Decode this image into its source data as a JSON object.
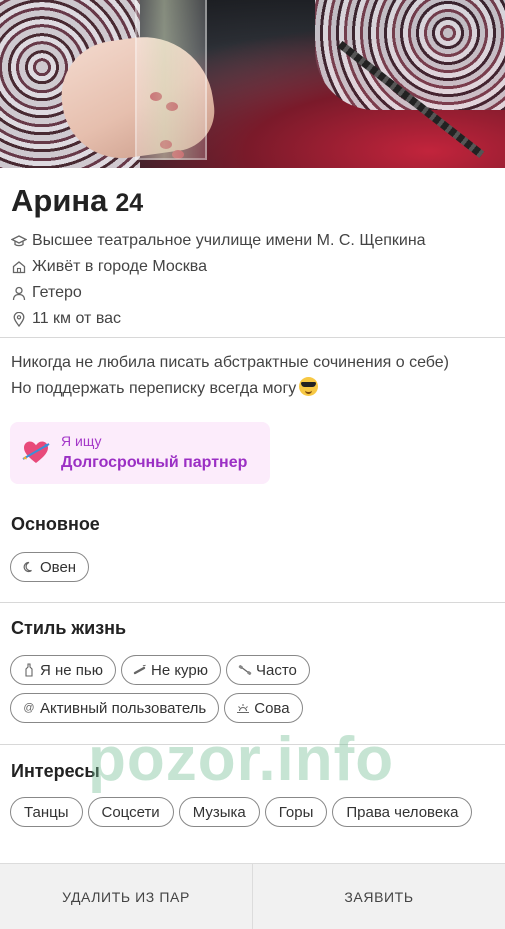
{
  "profile": {
    "name": "Арина",
    "age": "24",
    "facts": {
      "education": "Высшее театральное училище имени М. С. Щепкина",
      "city": "Живёт в городе Москва",
      "orientation": "Гетеро",
      "distance": "11 км от вас"
    },
    "bio_line1": "Никогда не любила писать абстрактные сочинения о себе)",
    "bio_line2": "Но поддержать переписку всегда могу"
  },
  "seeking": {
    "label": "Я ищу",
    "value": "Долгосрочный партнер"
  },
  "sections": {
    "basic": {
      "title": "Основное",
      "chips": [
        {
          "label": "Овен",
          "icon": "moon-icon"
        }
      ]
    },
    "lifestyle": {
      "title": "Стиль жизнь",
      "chips": [
        {
          "label": "Я не пью",
          "icon": "bottle-icon"
        },
        {
          "label": "Не курю",
          "icon": "cigarette-icon"
        },
        {
          "label": "Часто",
          "icon": "dumbbell-icon"
        },
        {
          "label": "Активный пользователь",
          "icon": "at-icon"
        },
        {
          "label": "Сова",
          "icon": "sunset-icon"
        }
      ]
    },
    "interests": {
      "title": "Интересы",
      "chips": [
        {
          "label": "Танцы"
        },
        {
          "label": "Соцсети"
        },
        {
          "label": "Музыка"
        },
        {
          "label": "Горы"
        },
        {
          "label": "Права человека"
        }
      ]
    }
  },
  "actions": {
    "remove_label": "УДАЛИТЬ ИЗ ПАР",
    "report_label": "ЗАЯВИТЬ"
  },
  "watermark": "pozor.info",
  "colors": {
    "seek_bg": "#fcecfb",
    "seek_text": "#9b2fc4",
    "watermark": "#76be96"
  }
}
